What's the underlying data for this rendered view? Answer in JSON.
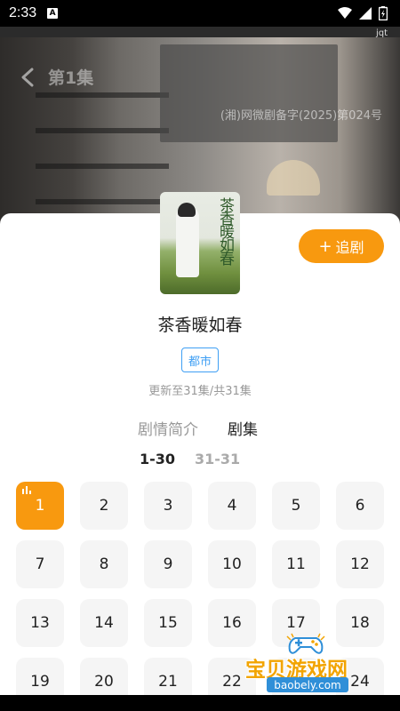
{
  "status_bar": {
    "time": "2:33",
    "app_icon_letter": "A",
    "wifi_icon": "wifi-icon",
    "signal_icon": "signal-icon",
    "battery_icon": "battery-charging-icon"
  },
  "video": {
    "overlay_label": "jqt",
    "episode_title": "第1集",
    "watermark": "(湘)网微剧备字(2025)第024号",
    "back_icon": "back-arrow-icon"
  },
  "drama": {
    "cover_text": "茶香暖如春",
    "title": "茶香暖如春",
    "genre": "都市",
    "update_status": "更新至31集/共31集",
    "follow_label": "追剧"
  },
  "tabs": {
    "synopsis": "剧情简介",
    "episodes": "剧集"
  },
  "episode_ranges": [
    "1-30",
    "31-31"
  ],
  "episodes": [
    "1",
    "2",
    "3",
    "4",
    "5",
    "6",
    "7",
    "8",
    "9",
    "10",
    "11",
    "12",
    "13",
    "14",
    "15",
    "16",
    "17",
    "18",
    "19",
    "20",
    "21",
    "22",
    "23",
    "24"
  ],
  "active_episode": "1",
  "site_watermark": {
    "name": "宝贝游戏网",
    "url": "baobely.com"
  },
  "colors": {
    "accent": "#f8990f",
    "tag_blue": "#3f9ff4",
    "cell_bg": "#f5f5f5"
  }
}
